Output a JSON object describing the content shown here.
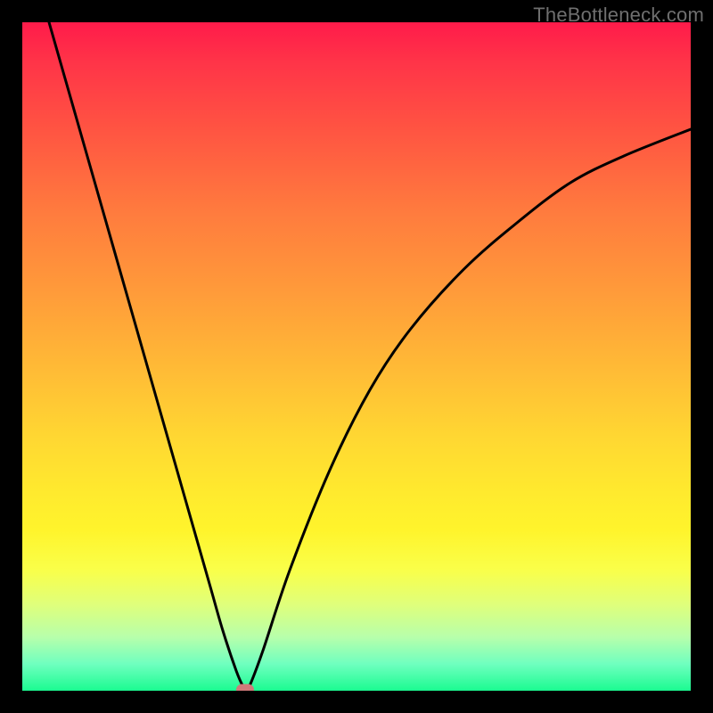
{
  "watermark": "TheBottleneck.com",
  "chart_data": {
    "type": "line",
    "title": "",
    "xlabel": "",
    "ylabel": "",
    "xlim": [
      0,
      100
    ],
    "ylim": [
      0,
      100
    ],
    "grid": false,
    "series": [
      {
        "name": "bottleneck-curve",
        "x": [
          4,
          8,
          12,
          16,
          20,
          24,
          28,
          30,
          32,
          33,
          33.5,
          34,
          36,
          40,
          46,
          52,
          58,
          66,
          74,
          82,
          90,
          100
        ],
        "y": [
          100,
          86,
          72,
          58,
          44,
          30,
          16,
          9,
          3,
          0.7,
          0.2,
          0.7,
          6,
          18,
          33,
          45,
          54,
          63,
          70,
          76,
          80,
          84
        ]
      },
      {
        "name": "optimal-marker",
        "x": [
          33.3
        ],
        "y": [
          0.2
        ]
      }
    ],
    "background_gradient": {
      "stops": [
        {
          "pos": 0,
          "color": "#ff1b4a"
        },
        {
          "pos": 50,
          "color": "#ffc234"
        },
        {
          "pos": 80,
          "color": "#fbff3a"
        },
        {
          "pos": 100,
          "color": "#1bfb91"
        }
      ]
    }
  }
}
